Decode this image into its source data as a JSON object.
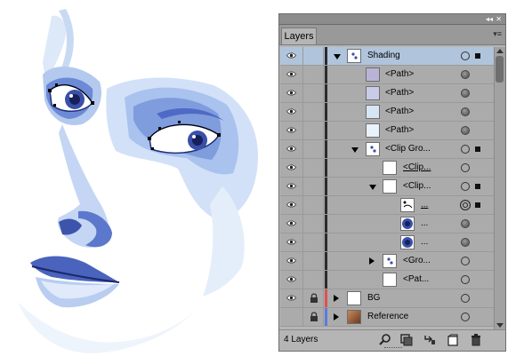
{
  "panel": {
    "title": "Layers",
    "collapse_label": "◂◂",
    "close_label": "✕",
    "menu_label": "▾≡",
    "footer": {
      "layer_count": "4 Layers"
    }
  },
  "rows": [
    {
      "label": "Shading",
      "level": 0,
      "twirl": "down",
      "target": "hollow",
      "selected_square": true,
      "row_selected": true,
      "bar_color": "#2b2b2b"
    },
    {
      "label": "<Path>",
      "level": 1,
      "twirl": "none",
      "target": "filled",
      "selected_square": false,
      "thumb_color": "#b8b4d8"
    },
    {
      "label": "<Path>",
      "level": 1,
      "twirl": "none",
      "target": "filled",
      "selected_square": false,
      "thumb_color": "#c8cce8"
    },
    {
      "label": "<Path>",
      "level": 1,
      "twirl": "none",
      "target": "filled",
      "selected_square": false,
      "thumb_color": "#d6e6f6"
    },
    {
      "label": "<Path>",
      "level": 1,
      "twirl": "none",
      "target": "filled",
      "selected_square": false,
      "thumb_color": "#e8f2fb"
    },
    {
      "label": "<Clip Gro...",
      "level": 1,
      "twirl": "down",
      "target": "hollow",
      "selected_square": true
    },
    {
      "label": "<Clip...",
      "level": 2,
      "twirl": "none",
      "target": "hollow",
      "selected_square": false,
      "underline": true
    },
    {
      "label": "<Clip...",
      "level": 2,
      "twirl": "down",
      "target": "hollow",
      "selected_square": true
    },
    {
      "label": "...",
      "level": 3,
      "twirl": "none",
      "target": "double",
      "selected_square": true,
      "underline": true
    },
    {
      "label": "...",
      "level": 3,
      "twirl": "none",
      "target": "filled",
      "selected_square": false
    },
    {
      "label": "...",
      "level": 3,
      "twirl": "none",
      "target": "filled",
      "selected_square": false
    },
    {
      "label": "<Gro...",
      "level": 2,
      "twirl": "right",
      "target": "hollow",
      "selected_square": false
    },
    {
      "label": "<Pat...",
      "level": 2,
      "twirl": "none",
      "target": "hollow",
      "selected_square": false
    },
    {
      "label": "BG",
      "level": 0,
      "twirl": "right",
      "target": "hollow",
      "selected_square": false,
      "locked": true,
      "bar_color": "#e05050"
    },
    {
      "label": "Reference",
      "level": 0,
      "twirl": "right",
      "target": "hollow",
      "selected_square": false,
      "locked": true,
      "eye_hidden": true,
      "bar_color": "#5a7ae0"
    }
  ],
  "colors": {
    "panel_bg": "#b5b5b5",
    "row_bg": "#ababab",
    "selected_row": "#b0c4dc",
    "artwork_blue": "#2c3f9a"
  },
  "icons": [
    "eye-icon",
    "lock-icon",
    "search-icon",
    "make-clipping-mask-icon",
    "new-sublayer-icon",
    "new-layer-icon",
    "delete-icon"
  ]
}
